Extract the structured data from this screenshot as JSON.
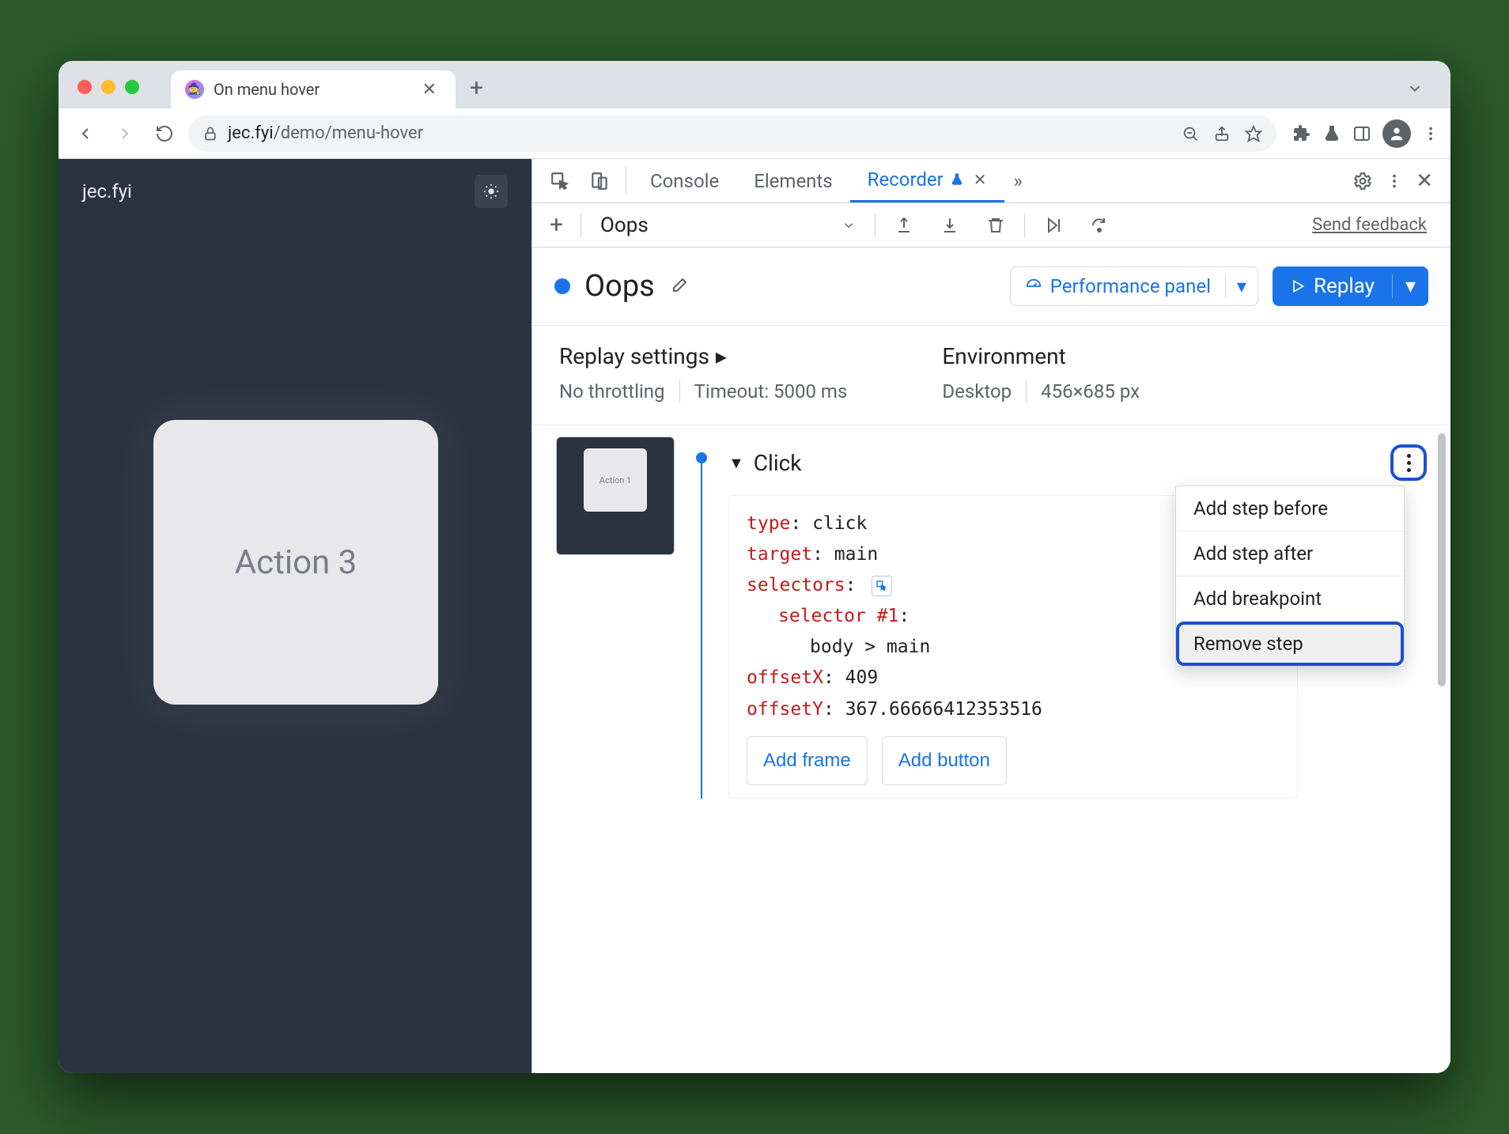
{
  "browser": {
    "tab_title": "On menu hover",
    "url_host": "jec.fyi",
    "url_path": "/demo/menu-hover"
  },
  "page": {
    "site_name": "jec.fyi",
    "card_label": "Action 3"
  },
  "devtools": {
    "tabs": {
      "console": "Console",
      "elements": "Elements",
      "recorder": "Recorder"
    },
    "recording_name": "Oops",
    "feedback_link": "Send feedback",
    "perf_panel": "Performance panel",
    "replay_btn": "Replay",
    "settings": {
      "replay_title": "Replay settings",
      "throttling": "No throttling",
      "timeout": "Timeout: 5000 ms",
      "env_title": "Environment",
      "env_device": "Desktop",
      "env_size": "456×685 px"
    },
    "thumb_label": "Action 1",
    "step": {
      "title": "Click",
      "type_k": "type",
      "type_v": ": click",
      "target_k": "target",
      "target_v": ": main",
      "selectors_k": "selectors",
      "selectors_v": ":",
      "sel1_k": "selector #1",
      "sel1_v": ":",
      "sel1_body": "body > main",
      "ox_k": "offsetX",
      "ox_v": ": 409",
      "oy_k": "offsetY",
      "oy_v": ": 367.66666412353516",
      "add_frame": "Add frame",
      "add_button": "Add button"
    },
    "context_menu": {
      "before": "Add step before",
      "after": "Add step after",
      "breakpoint": "Add breakpoint",
      "remove": "Remove step"
    }
  }
}
